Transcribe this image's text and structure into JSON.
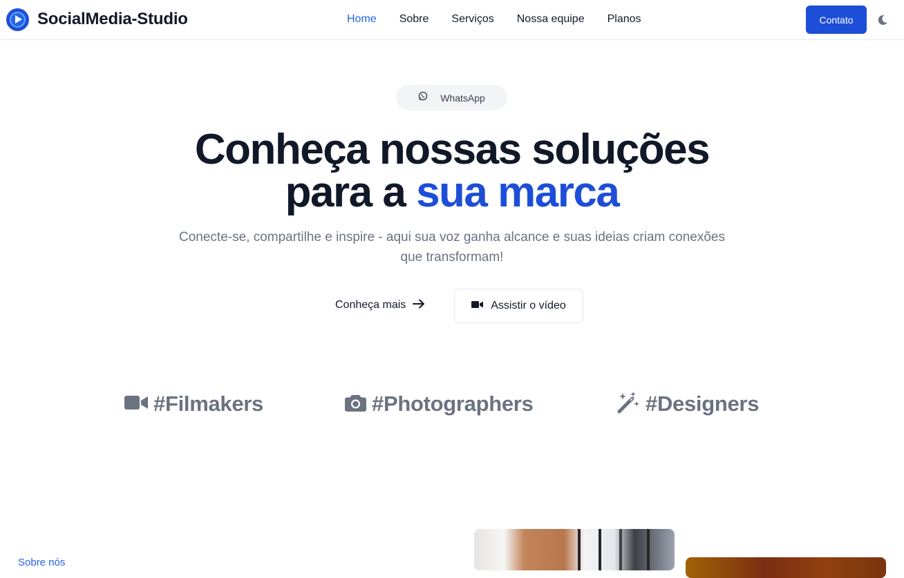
{
  "brand": {
    "name": "SocialMedia-Studio",
    "logo_icon": "play-circle-logo"
  },
  "nav": {
    "links": [
      {
        "label": "Home",
        "active": true
      },
      {
        "label": "Sobre",
        "active": false
      },
      {
        "label": "Serviços",
        "active": false
      },
      {
        "label": "Nossa equipe",
        "active": false
      },
      {
        "label": "Planos",
        "active": false
      }
    ],
    "contact_label": "Contato",
    "theme_icon": "moon-icon"
  },
  "hero": {
    "pill_label": "WhatsApp",
    "pill_icon": "whatsapp-icon",
    "title_line1": "Conheça nossas soluções",
    "title_line2_prefix": "para a ",
    "title_line2_accent": "sua marca",
    "subtitle": "Conecte-se, compartilhe e inspire - aqui sua voz ganha alcance e suas ideias criam conexões que transformam!",
    "cta_primary": "Conheça mais",
    "cta_video": "Assistir o vídeo"
  },
  "tags": [
    {
      "label": "#Filmakers",
      "icon": "video-camera-icon"
    },
    {
      "label": "#Photographers",
      "icon": "camera-icon"
    },
    {
      "label": "#Designers",
      "icon": "magic-wand-icon"
    }
  ],
  "section": {
    "label": "Sobre nós"
  },
  "colors": {
    "accent": "#1d4ed8",
    "link_active": "#2563eb",
    "text": "#111827",
    "muted": "#6b7280",
    "pill_bg": "#f3f4f6"
  }
}
